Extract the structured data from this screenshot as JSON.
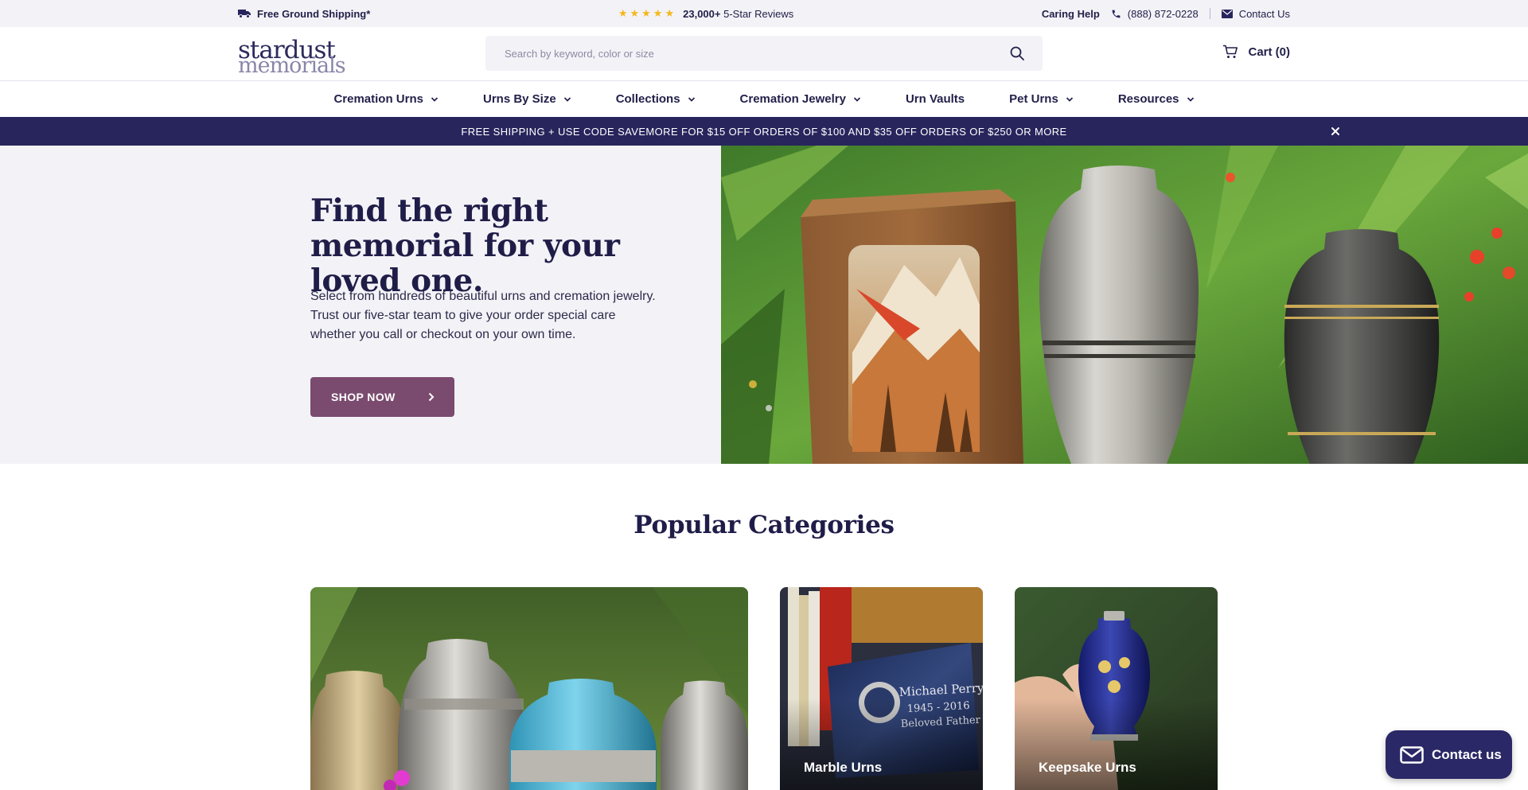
{
  "topbar": {
    "shipping": "Free Ground Shipping*",
    "stars": "★★★★★",
    "reviews_count": "23,000+",
    "reviews_label": "5-Star Reviews",
    "caring_help": "Caring Help",
    "phone": "(888) 872-0228",
    "contact": "Contact Us"
  },
  "header": {
    "logo_line1": "stardust",
    "logo_line2": "memorials",
    "search_placeholder": "Search by keyword, color or size",
    "cart": "Cart (0)"
  },
  "nav": {
    "items": [
      {
        "label": "Cremation Urns",
        "dropdown": true
      },
      {
        "label": "Urns By Size",
        "dropdown": true
      },
      {
        "label": "Collections",
        "dropdown": true
      },
      {
        "label": "Cremation Jewelry",
        "dropdown": true
      },
      {
        "label": "Urn Vaults",
        "dropdown": false
      },
      {
        "label": "Pet Urns",
        "dropdown": true
      },
      {
        "label": "Resources",
        "dropdown": true
      }
    ]
  },
  "promo": {
    "text": "FREE SHIPPING + USE CODE SAVEMORE FOR $15 OFF ORDERS OF $100 AND $35 OFF ORDERS OF $250 OR MORE"
  },
  "hero": {
    "title": "Find the right memorial for your loved one.",
    "text": "Select from hundreds of beautiful urns and cremation jewelry. Trust our five-star team to give your order special care whether you call or checkout on your own time.",
    "button": "SHOP NOW"
  },
  "categories": {
    "title": "Popular Categories",
    "items": [
      {
        "label": ""
      },
      {
        "label": "Marble Urns"
      },
      {
        "label": "Keepsake Urns"
      }
    ]
  },
  "contact_float": {
    "label": "Contact us"
  },
  "colors": {
    "brand_navy": "#27255c",
    "button_mauve": "#7a4b6f",
    "star_gold": "#f5b719",
    "hero_bg": "#f3f2f7"
  }
}
